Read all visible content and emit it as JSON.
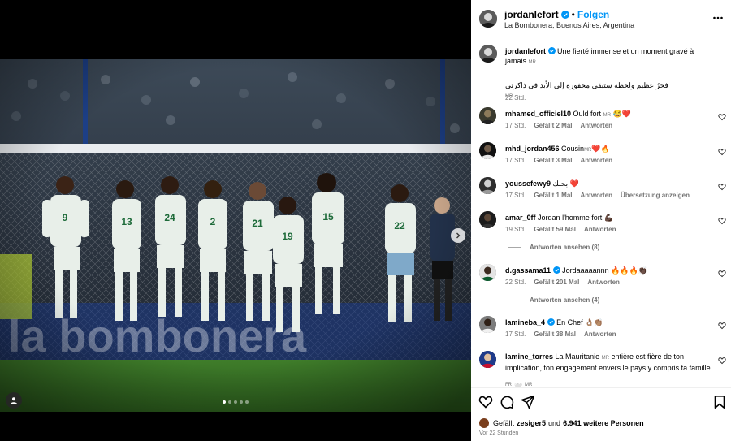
{
  "post": {
    "username": "jordanlefort",
    "follow_label": "Folgen",
    "separator": "•",
    "location": "La Bombonera, Buenos Aires, Argentina",
    "caption_fr": "Une fierté immense et un moment gravé à jamais",
    "caption_ar": "فخرٌ عظيم ولحظة ستبقى محفورة إلى الأبد في ذاكرتي",
    "flag_mr": "MR",
    "caption_time": "22 Std.",
    "carousel": {
      "current": 1,
      "total": 5
    }
  },
  "comments": [
    {
      "user": "mhamed_officiel10",
      "verified": false,
      "text": "Ould fort",
      "emoji": "😂❤️",
      "flag": "MR",
      "time": "17 Std.",
      "likes": "Gefällt 2 Mal",
      "reply": "Antworten"
    },
    {
      "user": "mhd_jordan456",
      "verified": false,
      "text": "Cousin",
      "emoji": "❤️🔥",
      "flag": "MR",
      "time": "17 Std.",
      "likes": "Gefällt 3 Mal",
      "reply": "Antworten"
    },
    {
      "user": "youssefewy9",
      "verified": false,
      "text": "بحبك",
      "emoji": "❤️",
      "flag": "",
      "time": "17 Std.",
      "likes": "Gefällt 1 Mal",
      "reply": "Antworten",
      "extra": "Übersetzung anzeigen"
    },
    {
      "user": "amar_0ff",
      "verified": false,
      "text": "Jordan l'homme fort",
      "emoji": "💪🏿",
      "flag": "",
      "time": "19 Std.",
      "likes": "Gefällt 59 Mal",
      "reply": "Antworten",
      "view_replies": "Antworten ansehen (8)"
    },
    {
      "user": "d.gassama11",
      "verified": true,
      "text": "Jordaaaaannn",
      "emoji": "🔥🔥🔥👏🏿",
      "flag": "",
      "time": "22 Std.",
      "likes": "Gefällt 201 Mal",
      "reply": "Antworten",
      "view_replies": "Antworten ansehen (4)"
    },
    {
      "user": "lamineba_4",
      "verified": true,
      "text": "En Chef",
      "emoji": "👌🏽👏🏽",
      "flag": "",
      "time": "17 Std.",
      "likes": "Gefällt 38 Mal",
      "reply": "Antworten"
    },
    {
      "user": "lamine_torres",
      "verified": false,
      "text": "La Mauritanie",
      "flag": "MR",
      "text2": "entière est fière de ton implication, ton engagement envers le pays y compris ta famille.",
      "trail_flag": "FR",
      "trail_flag2": "MR"
    }
  ],
  "footer": {
    "likes_prefix": "Gefällt",
    "liker": "zesiger5",
    "likes_mid": "und",
    "likes_count": "6.941 weitere Personen",
    "time": "Vor 22 Stunden"
  },
  "icons": {
    "like": "heart-icon",
    "comment": "comment-icon",
    "share": "share-icon",
    "save": "bookmark-icon",
    "more": "more-options-icon",
    "tag": "user-tag-icon",
    "next": "chevron-right-icon"
  },
  "colors": {
    "accent": "#0095f6",
    "verified": "#0095f6",
    "muted": "#737373",
    "jersey": "#e8efe9",
    "jersey_trim": "#1e6b3a"
  }
}
